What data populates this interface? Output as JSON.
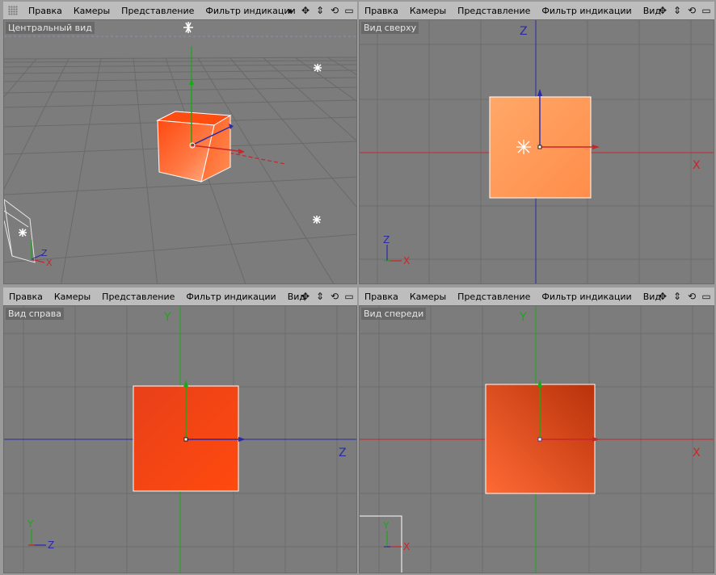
{
  "menus": {
    "editor_menu": [
      "Правка",
      "Камеры",
      "Представление",
      "Фильтр индикации"
    ],
    "full_menu": [
      "Правка",
      "Камеры",
      "Представление",
      "Фильтр индикации",
      "Вид"
    ]
  },
  "controls": {
    "expand_glyph": "▸",
    "move_glyph": "✥",
    "zoom_glyph": "⇕",
    "rotate_glyph": "⟲",
    "maximize_glyph": "▭"
  },
  "viewports": {
    "perspective": {
      "label": "Центральный вид"
    },
    "top": {
      "label": "Вид сверху",
      "axis_h": "X",
      "axis_v": "Z",
      "mini_v": "Z",
      "mini_h": "X"
    },
    "right": {
      "label": "Вид справа",
      "axis_h": "Z",
      "axis_v": "Y",
      "mini_v": "Y",
      "mini_h": "Z"
    },
    "front": {
      "label": "Вид спереди",
      "axis_h": "X",
      "axis_v": "Y",
      "mini_v": "Y",
      "mini_h": "X"
    }
  },
  "perspective_axes": {
    "z": "Z",
    "x": "X"
  },
  "colors": {
    "x_axis": "#c8262b",
    "y_axis": "#1aa81a",
    "z_axis": "#2a2aa8",
    "cube_top": "#ff9a55",
    "cube_side": "#ff4a10",
    "grid": "#6c6c6c"
  }
}
